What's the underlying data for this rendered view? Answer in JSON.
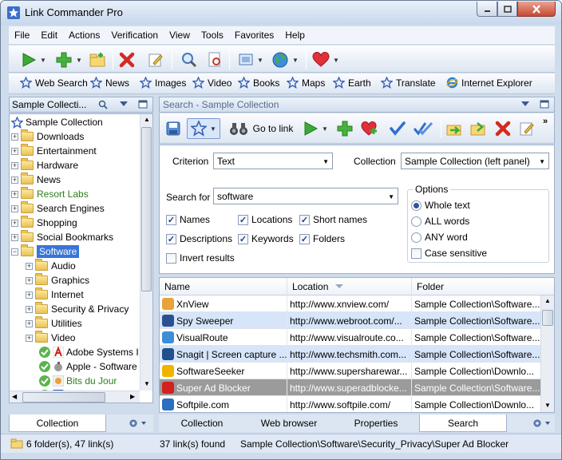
{
  "window": {
    "title": "Link Commander Pro",
    "minimize": "0",
    "maximize": "1",
    "close": "r"
  },
  "menu": [
    "File",
    "Edit",
    "Actions",
    "Verification",
    "View",
    "Tools",
    "Favorites",
    "Help"
  ],
  "favorites_bar": [
    "Web Search",
    "News",
    "Images",
    "Video",
    "Books",
    "Maps",
    "Earth",
    "Translate",
    "Internet Explorer"
  ],
  "left_panel": {
    "title": "Sample Collecti...",
    "root": "Sample Collection",
    "items": [
      {
        "label": "Downloads",
        "color": "#000000"
      },
      {
        "label": "Entertainment",
        "color": "#000000"
      },
      {
        "label": "Hardware",
        "color": "#000000"
      },
      {
        "label": "News",
        "color": "#000000"
      },
      {
        "label": "Resort Labs",
        "color": "#2e7d1e"
      },
      {
        "label": "Search Engines",
        "color": "#000000"
      },
      {
        "label": "Shopping",
        "color": "#000000"
      },
      {
        "label": "Social Bookmarks",
        "color": "#000000"
      },
      {
        "label": "Software",
        "color": "#ffffff"
      }
    ],
    "sub_items": [
      "Audio",
      "Graphics",
      "Internet",
      "Security & Privacy",
      "Utilities",
      "Video"
    ],
    "links": [
      {
        "label": "Adobe Systems I",
        "color": "#000000"
      },
      {
        "label": "Apple - Software",
        "color": "#000000"
      },
      {
        "label": "Bits du Jour",
        "color": "#2e7d1e"
      },
      {
        "label": "Corel Home Pag",
        "color": "#000000"
      }
    ],
    "tab": "Collection"
  },
  "right_panel": {
    "title": "Search - Sample Collection",
    "go_to_link": "Go to link",
    "criterion_label": "Criterion",
    "criterion_value": "Text",
    "collection_label": "Collection",
    "collection_value": "Sample Collection (left panel)",
    "search_for_label": "Search for",
    "search_for_value": "software",
    "checks": [
      {
        "label": "Names",
        "checked": true
      },
      {
        "label": "Locations",
        "checked": true
      },
      {
        "label": "Short names",
        "checked": true
      },
      {
        "label": "Descriptions",
        "checked": true
      },
      {
        "label": "Keywords",
        "checked": true
      },
      {
        "label": "Folders",
        "checked": true
      },
      {
        "label": "Invert results",
        "checked": false
      }
    ],
    "options": {
      "legend": "Options",
      "whole_text": "Whole text",
      "all_words": "ALL words",
      "any_word": "ANY word",
      "case_sensitive": "Case sensitive",
      "selected": "Whole text"
    },
    "columns": [
      "Name",
      "Location",
      "Folder"
    ],
    "rows": [
      {
        "name": "XnView",
        "location": "http://www.xnview.com/",
        "folder": "Sample Collection\\Software...",
        "icon_color": "#e8a33a",
        "state": "normal"
      },
      {
        "name": "Spy Sweeper",
        "location": "http://www.webroot.com/...",
        "folder": "Sample Collection\\Software...",
        "icon_color": "#2b4f8f",
        "state": "selected"
      },
      {
        "name": "VisualRoute",
        "location": "http://www.visualroute.co...",
        "folder": "Sample Collection\\Software...",
        "icon_color": "#3a8fd8",
        "state": "normal"
      },
      {
        "name": "Snagit | Screen capture ...",
        "location": "http://www.techsmith.com...",
        "folder": "Sample Collection\\Software...",
        "icon_color": "#1f4f8f",
        "state": "selected"
      },
      {
        "name": "SoftwareSeeker",
        "location": "http://www.supersharewar...",
        "folder": "Sample Collection\\Downlo...",
        "icon_color": "#f0b400",
        "state": "normal"
      },
      {
        "name": "Super Ad Blocker",
        "location": "http://www.superadblocke...",
        "folder": "Sample Collection\\Software...",
        "icon_color": "#d42020",
        "state": "focused"
      },
      {
        "name": "Softpile.com",
        "location": "http://www.softpile.com/",
        "folder": "Sample Collection\\Downlo...",
        "icon_color": "#2a6fc0",
        "state": "normal"
      }
    ],
    "tabs": [
      "Collection",
      "Web browser",
      "Properties",
      "Search"
    ],
    "active_tab": "Search"
  },
  "status": {
    "left": "6 folder(s), 47 link(s)",
    "count": "37 link(s) found",
    "path": "Sample Collection\\Software\\Security_Privacy\\Super Ad Blocker"
  }
}
